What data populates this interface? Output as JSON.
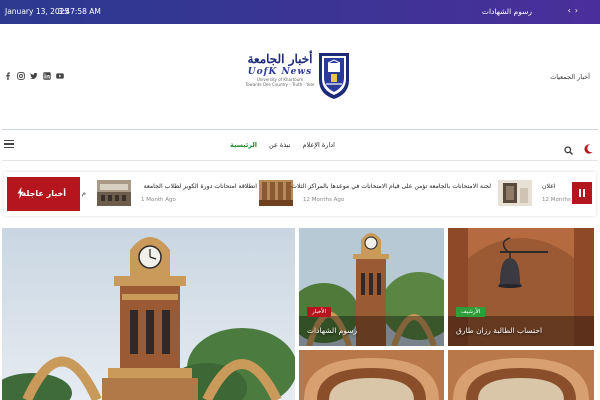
{
  "topbar": {
    "date": "January 13, 2025",
    "time": "3:47:58 AM",
    "ticker": "رسوم الشهادات",
    "arrow_prev": "‹",
    "arrow_next": "›"
  },
  "header": {
    "logo_ar": "أخبار الجامعة",
    "logo_en": "UofK News",
    "logo_sub1": "University of Khartoum",
    "logo_sub2": "Towards One Country - Truth - Year",
    "societies_link": "أخبار الجمعيات"
  },
  "nav": {
    "items": [
      {
        "label": "الرئيسية",
        "active": true
      },
      {
        "label": "نبذة عن"
      },
      {
        "label": "ادارة الإعلام"
      }
    ]
  },
  "breaking": {
    "label": "أخبار عاجلة",
    "items": [
      {
        "title": "اعلان",
        "ago": "12 Months Ago"
      },
      {
        "title": "لجنة الامتحانات بالجامعة تؤمن على قيام الامتحانات في موعدها بالمراكز الثلاث",
        "ago": "12 Months Ago"
      },
      {
        "title": "انطلاقة امتحانات دورة الكوبر لطلاب الجامعة",
        "ago": "1 Month Ago"
      },
      {
        "title": "م",
        "ago": ""
      }
    ]
  },
  "cards": [
    {
      "badge": "الأرشيف",
      "title": "احتساب الطالبة رزان طارق"
    },
    {
      "badge": "الأخبار",
      "title": "رسوم الشهادات"
    }
  ],
  "colors": {
    "topbar": "#2b3a8f",
    "accent_red": "#b5161d",
    "active_nav": "#1e8c2e",
    "badge_green": "#2e9e3a"
  }
}
